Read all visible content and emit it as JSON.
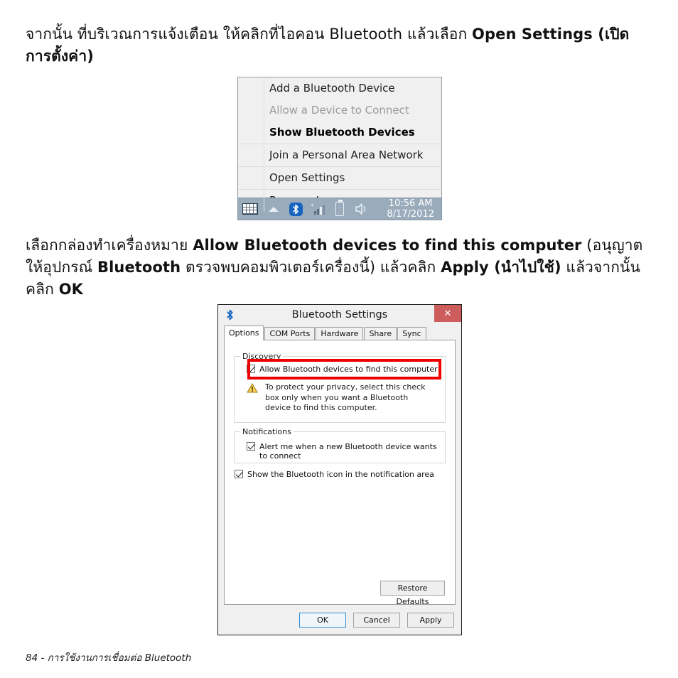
{
  "document": {
    "paragraph_1_html": "จากนั้น ที่บริเวณการแจ้งเตือน ให้คลิกที่ไอคอน Bluetooth แล้วเลือก <b>Open Settings (เปิดการตั้งค่า)</b>",
    "paragraph_2_html": "เลือกกล่องทำเครื่องหมาย <b>Allow Bluetooth devices to find this computer</b> (อนุญาตให้อุปกรณ์ <b>Bluetooth</b> ตรวจพบคอมพิวเตอร์เครื่องนี้) แล้วคลิก <b>Apply (นำไปใช้)</b> แล้วจากนั้นคลิก <b>OK</b>",
    "footer": "84 - การใช้งานการเชื่อมต่อ Bluetooth"
  },
  "tray_menu": {
    "groups": [
      {
        "items": [
          {
            "label": "Add a Bluetooth Device",
            "state": "normal"
          },
          {
            "label": "Allow a Device to Connect",
            "state": "disabled"
          },
          {
            "label": "Show Bluetooth Devices",
            "state": "bold"
          }
        ]
      },
      {
        "items": [
          {
            "label": "Join a Personal Area Network",
            "state": "normal"
          }
        ]
      },
      {
        "items": [
          {
            "label": "Open Settings",
            "state": "normal"
          }
        ]
      },
      {
        "items": [
          {
            "label": "Remove Icon",
            "state": "normal"
          }
        ]
      }
    ]
  },
  "taskbar": {
    "icons": [
      "keyboard-icon",
      "chevron-up-icon",
      "bluetooth-icon",
      "network-signal-icon",
      "battery-icon",
      "volume-icon"
    ],
    "clock": {
      "time": "10:56 AM",
      "date": "8/17/2012"
    },
    "background_color": "#9aabbc"
  },
  "dialog": {
    "title": "Bluetooth Settings",
    "title_icon": "bluetooth-icon",
    "close_label": "✕",
    "close_color": "#cd5c5c",
    "tabs": [
      {
        "label": "Options",
        "active": true
      },
      {
        "label": "COM Ports",
        "active": false
      },
      {
        "label": "Hardware",
        "active": false
      },
      {
        "label": "Share",
        "active": false
      },
      {
        "label": "Sync",
        "active": false
      }
    ],
    "discovery": {
      "group_label": "Discovery",
      "checkbox_label": "Allow Bluetooth devices to find this computer",
      "checkbox_checked": true,
      "warning_icon": "warning-triangle-icon",
      "warning_text": "To protect your privacy, select this check box only when you want a Bluetooth device to find this computer.",
      "highlight_color": "#ee0000"
    },
    "notifications": {
      "group_label": "Notifications",
      "checkbox_label": "Alert me when a new Bluetooth device wants to connect",
      "checkbox_checked": true
    },
    "show_icon": {
      "checkbox_label": "Show the Bluetooth icon in the notification area",
      "checkbox_checked": true
    },
    "restore_defaults_label": "Restore Defaults",
    "buttons": [
      {
        "label": "OK",
        "default": true
      },
      {
        "label": "Cancel",
        "default": false
      },
      {
        "label": "Apply",
        "default": false
      }
    ]
  }
}
